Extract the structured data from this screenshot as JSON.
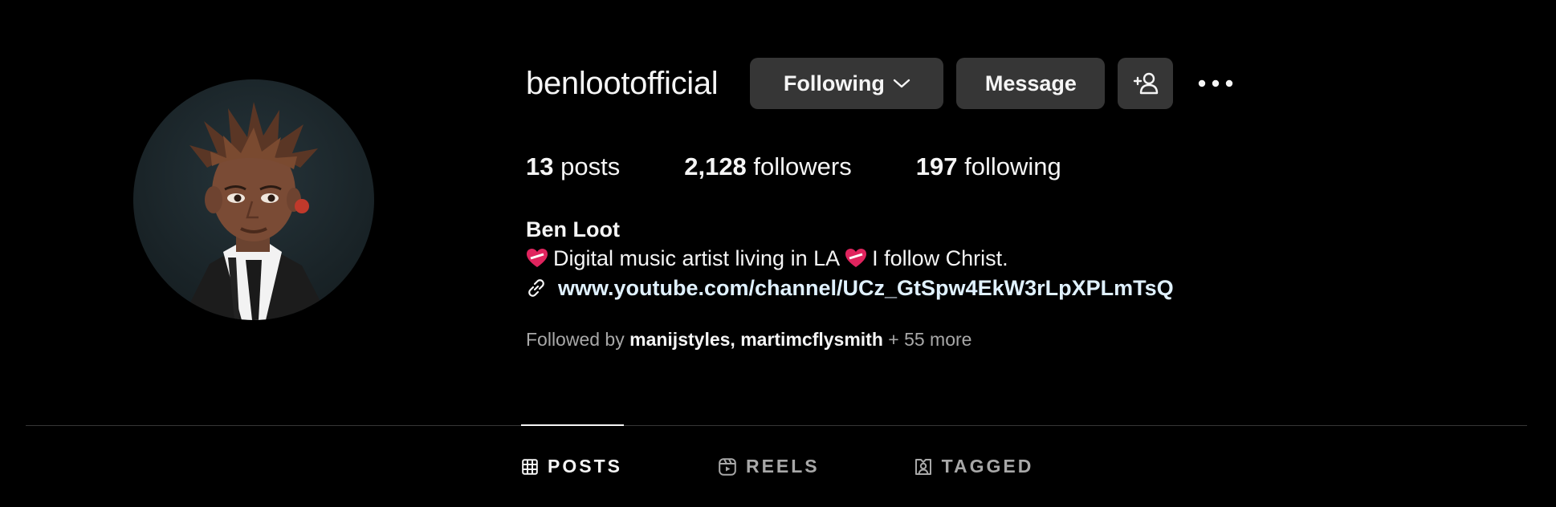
{
  "profile": {
    "username": "benlootofficial",
    "buttons": {
      "following_label": "Following",
      "message_label": "Message"
    },
    "stats": {
      "posts_count": "13",
      "posts_label": "posts",
      "followers_count": "2,128",
      "followers_label": "followers",
      "following_count": "197",
      "following_label": "following"
    },
    "bio": {
      "name": "Ben Loot",
      "line_part1": "Digital music artist living in LA",
      "line_part2": "I follow Christ.",
      "link": "www.youtube.com/channel/UCz_GtSpw4EkW3rLpXPLmTsQ"
    },
    "followed_by": {
      "prefix": "Followed by",
      "user1": "manijstyles",
      "separator": ",",
      "user2": "martimcflysmith",
      "suffix": "+ 55 more"
    }
  },
  "tabs": [
    {
      "label": "POSTS",
      "icon": "grid-icon",
      "active": true
    },
    {
      "label": "REELS",
      "icon": "reels-icon",
      "active": false
    },
    {
      "label": "TAGGED",
      "icon": "tagged-icon",
      "active": false
    }
  ],
  "colors": {
    "background": "#000000",
    "button": "#363636",
    "text": "#f5f5f5",
    "muted": "#a8a8a8",
    "link": "#e0f1ff",
    "heart": "#e0245e"
  }
}
